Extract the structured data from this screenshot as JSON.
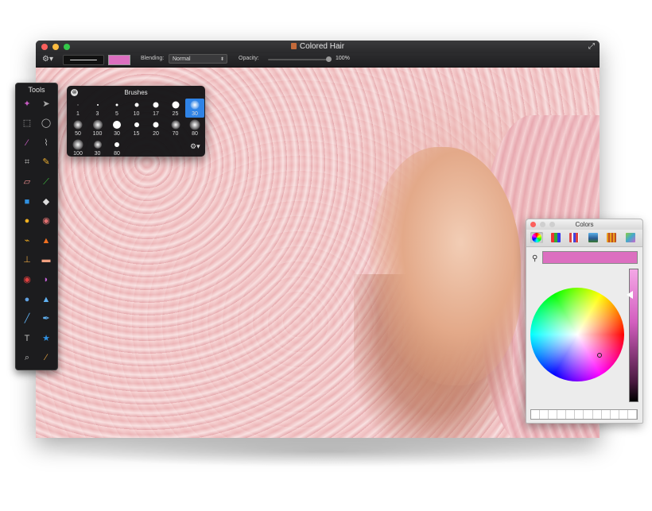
{
  "window": {
    "title": "Colored Hair",
    "icons": {
      "document": "document-icon",
      "fullscreen": "fullscreen-icon"
    }
  },
  "toolbar": {
    "gear_icon": "⚙▾",
    "current_color": "#dc6fc0",
    "blending_label": "Blending:",
    "blending_value": "Normal",
    "opacity_label": "Opacity:",
    "opacity_value": "100%",
    "opacity_fraction": 1.0
  },
  "tools": {
    "title": "Tools",
    "items": [
      {
        "name": "magic-wand-icon",
        "glyph": "✦",
        "color": "#c45ac0"
      },
      {
        "name": "arrow-select-icon",
        "glyph": "➤",
        "color": "#aaaaaa"
      },
      {
        "name": "rect-marquee-icon",
        "glyph": "⬚",
        "color": "#bbbbbb"
      },
      {
        "name": "ellipse-marquee-icon",
        "glyph": "◯",
        "color": "#bbbbbb"
      },
      {
        "name": "eyedropper-icon",
        "glyph": "⁄",
        "color": "#d060c8"
      },
      {
        "name": "lasso-icon",
        "glyph": "⌇",
        "color": "#bbbbbb"
      },
      {
        "name": "crop-icon",
        "glyph": "⌗",
        "color": "#bbbbbb"
      },
      {
        "name": "pencil-icon",
        "glyph": "✎",
        "color": "#f0b030"
      },
      {
        "name": "eraser-icon",
        "glyph": "▱",
        "color": "#f09090"
      },
      {
        "name": "brush-icon",
        "glyph": "⟋",
        "color": "#40c040"
      },
      {
        "name": "rectangle-shape-icon",
        "glyph": "■",
        "color": "#3090e0"
      },
      {
        "name": "paint-bucket-icon",
        "glyph": "◆",
        "color": "#dddddd"
      },
      {
        "name": "sponge-icon",
        "glyph": "●",
        "color": "#f0b020"
      },
      {
        "name": "gradient-icon",
        "glyph": "◉",
        "color": "#e07070"
      },
      {
        "name": "smudge-icon",
        "glyph": "⌁",
        "color": "#e0a020"
      },
      {
        "name": "burn-icon",
        "glyph": "▲",
        "color": "#f07020"
      },
      {
        "name": "stamp-icon",
        "glyph": "⊥",
        "color": "#e0a040"
      },
      {
        "name": "bandage-icon",
        "glyph": "▬",
        "color": "#f0a080"
      },
      {
        "name": "red-eye-icon",
        "glyph": "◉",
        "color": "#e04040"
      },
      {
        "name": "dodge-icon",
        "glyph": "◗",
        "color": "#c060d0"
      },
      {
        "name": "blur-drop-icon",
        "glyph": "●",
        "color": "#60a0e0"
      },
      {
        "name": "sharpen-icon",
        "glyph": "▲",
        "color": "#60b0f0"
      },
      {
        "name": "line-icon",
        "glyph": "╱",
        "color": "#60b0f0"
      },
      {
        "name": "pen-icon",
        "glyph": "✒",
        "color": "#60b0f0"
      },
      {
        "name": "text-icon",
        "glyph": "T",
        "color": "#bbbbbb"
      },
      {
        "name": "star-shape-icon",
        "glyph": "★",
        "color": "#3090e0"
      },
      {
        "name": "zoom-icon",
        "glyph": "⌕",
        "color": "#bbbbbb"
      },
      {
        "name": "color-picker-icon",
        "glyph": "⁄",
        "color": "#e0a040"
      }
    ]
  },
  "brushes": {
    "title": "Brushes",
    "close_icon": "⊗",
    "gear_icon": "⚙▾",
    "selected_color": "#2f83e6",
    "items": [
      {
        "label": "1",
        "dot": 1,
        "blur": false
      },
      {
        "label": "3",
        "dot": 2,
        "blur": false
      },
      {
        "label": "5",
        "dot": 3,
        "blur": false
      },
      {
        "label": "10",
        "dot": 5,
        "blur": false
      },
      {
        "label": "17",
        "dot": 7,
        "blur": false
      },
      {
        "label": "25",
        "dot": 9,
        "blur": false
      },
      {
        "label": "30",
        "dot": 7,
        "blur": true,
        "selected": true
      },
      {
        "label": "50",
        "dot": 7,
        "blur": true
      },
      {
        "label": "100",
        "dot": 8,
        "blur": true
      },
      {
        "label": "30",
        "dot": 10,
        "blur": false
      },
      {
        "label": "15",
        "dot": 6,
        "blur": false
      },
      {
        "label": "20",
        "dot": 7,
        "blur": false
      },
      {
        "label": "70",
        "dot": 7,
        "blur": true
      },
      {
        "label": "80",
        "dot": 9,
        "blur": true
      },
      {
        "label": "100",
        "dot": 9,
        "blur": true
      },
      {
        "label": "30",
        "dot": 6,
        "blur": true
      },
      {
        "label": "80",
        "dot": 6,
        "blur": false
      }
    ]
  },
  "colors": {
    "title": "Colors",
    "current_color": "#dc6fc0",
    "modes": [
      {
        "name": "color-wheel-mode-icon",
        "active": true
      },
      {
        "name": "sliders-mode-icon",
        "active": false
      },
      {
        "name": "palettes-mode-icon",
        "active": false
      },
      {
        "name": "image-palette-mode-icon",
        "active": false
      },
      {
        "name": "pencils-mode-icon",
        "active": false
      },
      {
        "name": "extra-mode-icon",
        "active": false
      }
    ],
    "search_icon": "magnifier-icon",
    "swatch_count": 12
  }
}
